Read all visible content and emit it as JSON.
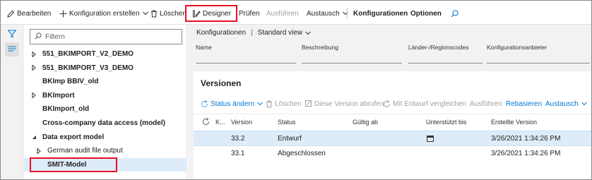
{
  "toolbar": {
    "edit_label": "Bearbeiten",
    "create_config_label": "Konfiguration erstellen",
    "delete_label": "Löschen",
    "designer_label": "Designer",
    "check_label": "Prüfen",
    "run_label": "Ausführen",
    "exchange_label": "Austausch",
    "configurations_label": "Konfigurationen",
    "options_label": "Optionen"
  },
  "tree": {
    "filter_placeholder": "Filtern",
    "items": [
      {
        "label": "551_BKIMPORT_V2_DEMO",
        "state": "collapsed",
        "selected": false
      },
      {
        "label": "551_BKIMPORT_V3_DEMO",
        "state": "collapsed",
        "selected": false
      },
      {
        "label": "BKImp BBIV_old",
        "state": "leaf",
        "selected": false
      },
      {
        "label": "BKImport",
        "state": "collapsed",
        "selected": false
      },
      {
        "label": "BKImport_old",
        "state": "leaf",
        "selected": false
      },
      {
        "label": "Cross-company data access (model)",
        "state": "leaf",
        "selected": false
      },
      {
        "label": "Data export model",
        "state": "expanded",
        "selected": false
      },
      {
        "label": "German audit file output",
        "state": "collapsed",
        "selected": false
      },
      {
        "label": "SMIT-Model",
        "state": "leaf",
        "selected": true
      }
    ]
  },
  "header": {
    "breadcrumb_root": "Konfigurationen",
    "view_name": "Standard view",
    "fields": {
      "name": "Name",
      "description": "Beschreibung",
      "region_codes": "Länder-/Regionscodes",
      "provider": "Konfigurationsanbieter"
    }
  },
  "versions": {
    "title": "Versionen",
    "actions": {
      "change_status": "Status ändern",
      "delete": "Löschen",
      "get_version": "Diese Version abrufen",
      "compare_draft": "Mit Entwurf vergleichen",
      "run": "Ausführen",
      "rebase": "Rebasieren",
      "exchange": "Austausch"
    },
    "columns": {
      "k": "K...",
      "version": "Version",
      "status": "Status",
      "valid_from": "Gültig ab",
      "supported_until": "Unterstützt bis",
      "created_version": "Erstellte Version"
    },
    "rows": [
      {
        "version": "33.2",
        "status": "Entwurf",
        "valid_from": "",
        "created": "3/26/2021 1:34:26 PM",
        "selected": true
      },
      {
        "version": "33.1",
        "status": "Abgeschlossen",
        "valid_from": "",
        "created": "3/26/2021 1:34:26 PM",
        "selected": false
      }
    ]
  },
  "colors": {
    "accent": "#0078d4",
    "highlight_box": "#e81123",
    "selected_row": "#deecf9"
  }
}
